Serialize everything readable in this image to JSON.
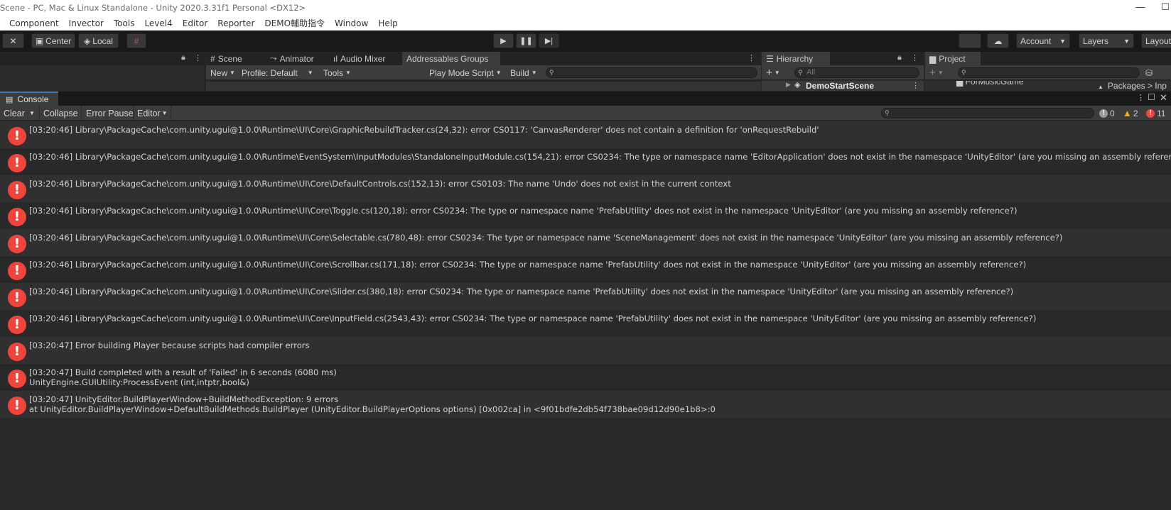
{
  "window": {
    "title": "Scene - PC, Mac & Linux Standalone - Unity 2020.3.31f1 Personal <DX12>",
    "minimize_glyph": "—",
    "maximize_glyph": "☐"
  },
  "menu": [
    "Component",
    "Invector",
    "Tools",
    "Level4",
    "Editor",
    "Reporter",
    "DEMO輔助指令",
    "Window",
    "Help"
  ],
  "toolbar": {
    "center_label": "Center",
    "local_label": "Local",
    "account_label": "Account",
    "layers_label": "Layers",
    "layout_label": "Layout"
  },
  "upper_dock": {
    "center_tabs": [
      "Scene",
      "Animator",
      "Audio Mixer",
      "Addressables Groups"
    ],
    "addressables_toolbar": {
      "new_label": "New",
      "profile_label": "Profile: Default",
      "tools_label": "Tools",
      "play_mode_label": "Play Mode Script",
      "build_label": "Build"
    },
    "hierarchy": {
      "tab_label": "Hierarchy",
      "search_placeholder": "All",
      "scene_item": "DemoStartScene"
    },
    "project": {
      "tab_label": "Project",
      "folder_item": "ForMusicGame",
      "packages_label": "Packages"
    }
  },
  "console": {
    "tab_label": "Console",
    "toolbar": {
      "clear_label": "Clear",
      "collapse_label": "Collapse",
      "error_pause_label": "Error Pause",
      "editor_label": "Editor"
    },
    "counts": {
      "info": "0",
      "warnings": "2",
      "errors": "11"
    },
    "colors": {
      "error": "#f0443d",
      "warning": "#f4b400",
      "info": "#9a9a9a",
      "tab_accent": "#3a79bb"
    },
    "logs": [
      {
        "line1": "[03:20:46] Library\\PackageCache\\com.unity.ugui@1.0.0\\Runtime\\UI\\Core\\GraphicRebuildTracker.cs(24,32): error CS0117: 'CanvasRenderer' does not contain a definition for 'onRequestRebuild'",
        "line2": ""
      },
      {
        "line1": "[03:20:46] Library\\PackageCache\\com.unity.ugui@1.0.0\\Runtime\\EventSystem\\InputModules\\StandaloneInputModule.cs(154,21): error CS0234: The type or namespace name 'EditorApplication' does not exist in the namespace 'UnityEditor' (are you missing an assembly reference?)",
        "line2": ""
      },
      {
        "line1": "[03:20:46] Library\\PackageCache\\com.unity.ugui@1.0.0\\Runtime\\UI\\Core\\DefaultControls.cs(152,13): error CS0103: The name 'Undo' does not exist in the current context",
        "line2": ""
      },
      {
        "line1": "[03:20:46] Library\\PackageCache\\com.unity.ugui@1.0.0\\Runtime\\UI\\Core\\Toggle.cs(120,18): error CS0234: The type or namespace name 'PrefabUtility' does not exist in the namespace 'UnityEditor' (are you missing an assembly reference?)",
        "line2": ""
      },
      {
        "line1": "[03:20:46] Library\\PackageCache\\com.unity.ugui@1.0.0\\Runtime\\UI\\Core\\Selectable.cs(780,48): error CS0234: The type or namespace name 'SceneManagement' does not exist in the namespace 'UnityEditor' (are you missing an assembly reference?)",
        "line2": ""
      },
      {
        "line1": "[03:20:46] Library\\PackageCache\\com.unity.ugui@1.0.0\\Runtime\\UI\\Core\\Scrollbar.cs(171,18): error CS0234: The type or namespace name 'PrefabUtility' does not exist in the namespace 'UnityEditor' (are you missing an assembly reference?)",
        "line2": ""
      },
      {
        "line1": "[03:20:46] Library\\PackageCache\\com.unity.ugui@1.0.0\\Runtime\\UI\\Core\\Slider.cs(380,18): error CS0234: The type or namespace name 'PrefabUtility' does not exist in the namespace 'UnityEditor' (are you missing an assembly reference?)",
        "line2": ""
      },
      {
        "line1": "[03:20:46] Library\\PackageCache\\com.unity.ugui@1.0.0\\Runtime\\UI\\Core\\InputField.cs(2543,43): error CS0234: The type or namespace name 'PrefabUtility' does not exist in the namespace 'UnityEditor' (are you missing an assembly reference?)",
        "line2": ""
      },
      {
        "line1": "[03:20:47] Error building Player because scripts had compiler errors",
        "line2": ""
      },
      {
        "line1": "[03:20:47] Build completed with a result of 'Failed' in 6 seconds (6080 ms)",
        "line2": "UnityEngine.GUIUtility:ProcessEvent (int,intptr,bool&)"
      },
      {
        "line1": "[03:20:47] UnityEditor.BuildPlayerWindow+BuildMethodException: 9 errors",
        "line2": " at UnityEditor.BuildPlayerWindow+DefaultBuildMethods.BuildPlayer (UnityEditor.BuildPlayerOptions options) [0x002ca] in <9f01bdfe2db54f738bae09d12d90e1b8>:0"
      }
    ]
  }
}
